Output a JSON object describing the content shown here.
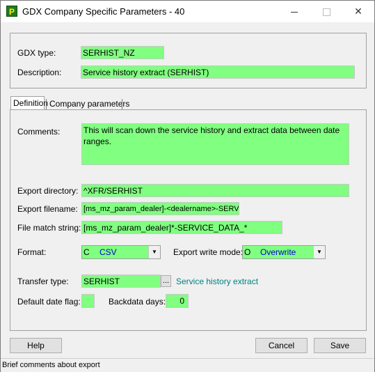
{
  "window": {
    "title": "GDX Company Specific Parameters - 40",
    "app_icon_letter": "P",
    "minimize_icon": "minimize-icon",
    "maximize_icon": "maximize-icon",
    "close_icon": "close-icon",
    "close_glyph": "✕"
  },
  "header": {
    "gdx_type_label": "GDX type:",
    "gdx_type_value": "SERHIST_NZ",
    "description_label": "Description:",
    "description_value": "Service history extract (SERHIST)"
  },
  "tabs": [
    {
      "label": "Definition",
      "active": true
    },
    {
      "label": "Company parameters",
      "active": false
    }
  ],
  "definition": {
    "comments_label": "Comments:",
    "comments_value": "This will scan down the service history and extract data between date ranges.",
    "export_directory_label": "Export directory:",
    "export_directory_value": "^XFR/SERHIST",
    "export_filename_label": "Export filename:",
    "export_filename_value": "[ms_mz_param_dealer]-<dealername>-SERVICE",
    "file_match_label": "File match string:",
    "file_match_value": "[ms_mz_param_dealer]*-SERVICE_DATA_*",
    "format_label": "Format:",
    "format_code": "C",
    "format_value": "CSV",
    "export_write_mode_label": "Export write mode:",
    "write_mode_code": "O",
    "write_mode_value": "Overwrite",
    "transfer_type_label": "Transfer type:",
    "transfer_type_value": "SERHIST",
    "transfer_lookup_label": "...",
    "transfer_type_description": "Service history extract",
    "default_date_flag_label": "Default date flag:",
    "default_date_flag_value": "",
    "backdata_days_label": "Backdata days:",
    "backdata_days_value": "0"
  },
  "buttons": {
    "help": "Help",
    "cancel": "Cancel",
    "save": "Save"
  },
  "status_bar": {
    "text": "Brief comments about export"
  },
  "colors": {
    "field_bg": "#80ff80",
    "link": "#008080",
    "combo_value": "#0000cc"
  }
}
